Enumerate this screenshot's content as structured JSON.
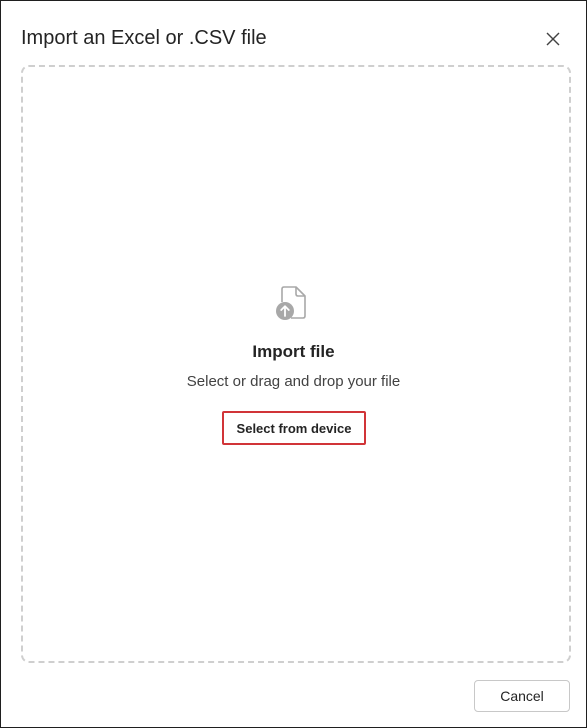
{
  "dialog": {
    "title": "Import an Excel or .CSV file",
    "close_icon": "close-icon"
  },
  "drop_zone": {
    "icon": "file-upload-icon",
    "title": "Import file",
    "subtitle": "Select or drag and drop your file",
    "select_button_label": "Select from device"
  },
  "footer": {
    "cancel_label": "Cancel"
  },
  "colors": {
    "highlight_border": "#d13438",
    "dashed_border": "#cfcfcf",
    "icon_gray": "#a8a8a8"
  }
}
